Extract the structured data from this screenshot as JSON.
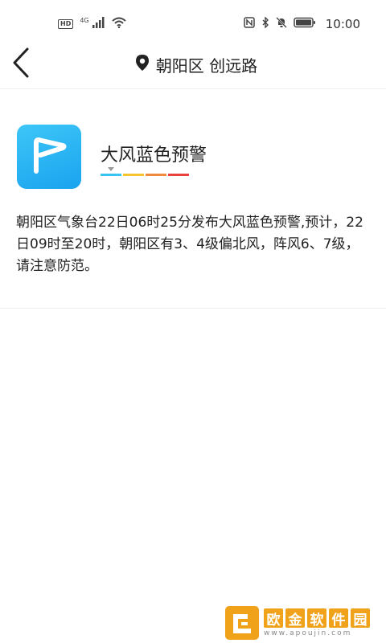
{
  "status_bar": {
    "hd": "HD",
    "network": "4G",
    "time": "10:00",
    "icons": [
      "hd-icon",
      "signal-icon",
      "wifi-icon",
      "nfc-icon",
      "bluetooth-icon",
      "mute-bell-icon",
      "battery-icon"
    ]
  },
  "header": {
    "back_icon": "chevron-left-icon",
    "location_icon": "location-pin-icon",
    "location": "朝阳区 创远路"
  },
  "alert": {
    "icon": "wind-flag-icon",
    "title": "大风蓝色预警",
    "level_colors": [
      "#3ac4f2",
      "#f5c531",
      "#f08a3c",
      "#e8423f"
    ],
    "body": "朝阳区气象台22日06时25分发布大风蓝色预警,预计，22日09时至20时，朝阳区有3、4级偏北风，阵风6、7级，请注意防范。"
  },
  "watermark": {
    "chars": [
      "欧",
      "金",
      "软",
      "件",
      "园"
    ],
    "url": "www.apoujin.com"
  },
  "colors": {
    "accent_blue": "#1aa3ef",
    "watermark_orange": "#f0a21b"
  }
}
